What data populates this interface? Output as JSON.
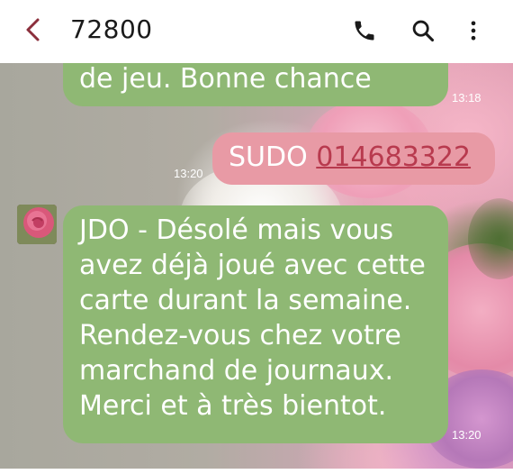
{
  "header": {
    "title": "72800"
  },
  "messages": [
    {
      "direction": "incoming",
      "text": "de jeu. Bonne chance",
      "time": "13:18"
    },
    {
      "direction": "outgoing",
      "text_prefix": "SUDO ",
      "link": "014683322",
      "time": "13:20"
    },
    {
      "direction": "incoming",
      "lines": [
        "JDO - Désolé mais vous",
        "avez déjà joué avec cette",
        "carte durant la semaine.",
        "Rendez-vous chez votre",
        "marchand de journaux.",
        "Merci et à très bientot."
      ],
      "time": "13:20"
    }
  ],
  "icons": {
    "back": "chevron-left-icon",
    "call": "phone-icon",
    "search": "search-icon",
    "more": "more-vert-icon"
  },
  "colors": {
    "incoming_bubble": "#8fb874",
    "outgoing_bubble": "#e89aa5",
    "back_chevron": "#8b2f3c",
    "link": "#b83a4e"
  }
}
